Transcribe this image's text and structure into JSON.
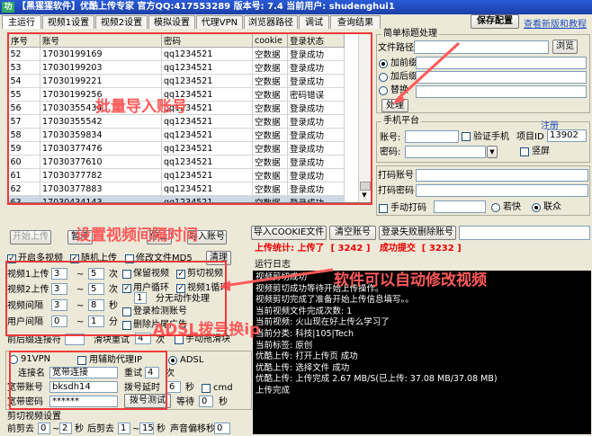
{
  "window": {
    "title": "【黑猩猩软件】优酷上传专家 官方QQ:417553289 版本号: 7.4 当前用户: shudenghui1"
  },
  "tabs": [
    "主运行",
    "视频1设置",
    "视频2设置",
    "模拟设置",
    "代理VPN",
    "浏览器路径",
    "调试",
    "查询结果"
  ],
  "header_buttons": {
    "save": "保存配置",
    "latest": "查看新版和教程"
  },
  "accounts": {
    "columns": [
      "序号",
      "账号",
      "密码",
      "cookie",
      "登录状态"
    ],
    "rows": [
      [
        "52",
        "17030199169",
        "qq1234521",
        "空数据",
        "登录成功"
      ],
      [
        "53",
        "17030199203",
        "qq1234521",
        "空数据",
        "登录成功"
      ],
      [
        "54",
        "17030199221",
        "qq1234521",
        "空数据",
        "登录成功"
      ],
      [
        "55",
        "17030199256",
        "qq1234521",
        "空数据",
        "密码错误"
      ],
      [
        "56",
        "17030355434",
        "qq1234521",
        "空数据",
        "登录成功"
      ],
      [
        "57",
        "17030355542",
        "qq1234521",
        "空数据",
        "登录成功"
      ],
      [
        "58",
        "17030359834",
        "qq1234521",
        "空数据",
        "登录成功"
      ],
      [
        "59",
        "17030377476",
        "qq1234521",
        "空数据",
        "登录成功"
      ],
      [
        "60",
        "17030377610",
        "qq1234521",
        "空数据",
        "登录成功"
      ],
      [
        "61",
        "17030377782",
        "qq1234521",
        "空数据",
        "登录成功"
      ],
      [
        "62",
        "17030377883",
        "qq1234521",
        "空数据",
        "登录成功"
      ],
      [
        "63",
        "17030434143",
        "qq1234521",
        "空数据",
        "登录成功"
      ]
    ]
  },
  "simple_title": {
    "group": "简单标题处理",
    "path_label": "文件路径",
    "browse": "浏览",
    "opt1": "加前缀",
    "opt2": "加后缀",
    "opt3": "替换",
    "process": "处理"
  },
  "sms": {
    "group": "手机平台",
    "account": "账号:",
    "password": "密码:",
    "verify": "验证手机",
    "project_id_label": "项目ID",
    "project_id": "13902",
    "register": "注册",
    "vertical": "竖屏"
  },
  "captcha": {
    "account": "打码账号",
    "password": "打码密码",
    "manual": "手动打码",
    "fast": "若快",
    "lianzhong": "联众"
  },
  "actions": {
    "start_upload": "开始上传",
    "pause": "暂停",
    "stop": "停止",
    "import_account": "导入账号",
    "import_cookie": "导入COOKIE文件",
    "clear_accounts": "清空账号",
    "clear_failed": "登录失败删除账号"
  },
  "stats": {
    "upload_label": "上传统计: 上传了",
    "uploaded": "3242",
    "success_label": "成功提交",
    "success": "3232"
  },
  "options": {
    "multi_video": "开启多视频",
    "random_upload": "随机上传",
    "modify_md5": "修改文件MD5",
    "clear": "清理",
    "v1_upload": "视频1上传",
    "v1_a": "3",
    "v1_b": "5",
    "keep_video": "保留视频",
    "cut_video": "剪切视频",
    "v2_upload": "视频2上传",
    "v2_a": "3",
    "v2_b": "5",
    "user_loop": "用户循环",
    "v1_loop": "视频1循环",
    "video_interval": "视频间隔",
    "vi_a": "3",
    "vi_b": "8",
    "split_label": "分无动作处理",
    "split_val": "1",
    "user_interval": "用户间隔",
    "ui_a": "0",
    "ui_b": "1",
    "login_check": "登录检测账号",
    "delete_ad": "删除片尾广告",
    "front_back": "前后缀连接符",
    "slider_retry": "滑块重试",
    "slider_val": "4",
    "unit_times": "次",
    "manual_slider": "手动拖滑块",
    "unit_min": "分",
    "unit_sec": "秒",
    "to": "~"
  },
  "adsl": {
    "vpn": "91VPN",
    "use_proxy": "用辅助代理IP",
    "adsl": "ADSL",
    "conn_name_label": "连接名",
    "conn_name": "宽带连接",
    "retry_label": "重试",
    "retry": "4",
    "times": "次",
    "acc_label": "宽带账号",
    "acc": "bksdh14",
    "delay_label": "拨号延时",
    "delay": "6",
    "sec": "秒",
    "cmd": "cmd",
    "pwd_label": "宽带密码",
    "pwd": "******",
    "test_btn": "拨号测试",
    "wait_label": "等待",
    "wait": "0",
    "sec2": "秒"
  },
  "cut": {
    "group": "剪切视频设置",
    "front_cut": "前剪去",
    "f_a": "0",
    "f_b": "2",
    "sec": "秒",
    "back_cut": "后剪去",
    "b_a": "1",
    "b_b": "15",
    "sec2": "秒",
    "audio_shift": "声音偏移秒",
    "audio_val": "0"
  },
  "log": {
    "title": "运行日志",
    "lines": [
      "视频剪切成功",
      "视频剪切成功等待开始上传操作。",
      "视频剪切完成了准备开始上传信息填写。。",
      "当前视频文件完成次数: 1",
      "当前视频: 火山现在好上传么学习了",
      "当前分类: 科技|105|Tech",
      "当前标签: 原创",
      "优酷上传: 打开上传页 成功",
      "优酷上传: 选择文件 成功",
      "优酷上传: 上传完成 2.67 MB/S(已上传: 37.08 MB/37.08 MB)",
      "上传完成"
    ]
  },
  "annotations": {
    "bulk_import": "批量导入账号",
    "interval": "设置视频间隔时间",
    "auto_modify": "软件可以自动修改视频",
    "adsl": "ADSL拨号换ip"
  },
  "colors": {
    "annotation": "#ff5a5a",
    "log_bg": "#000000",
    "title_blue": "#1a3fa8"
  }
}
